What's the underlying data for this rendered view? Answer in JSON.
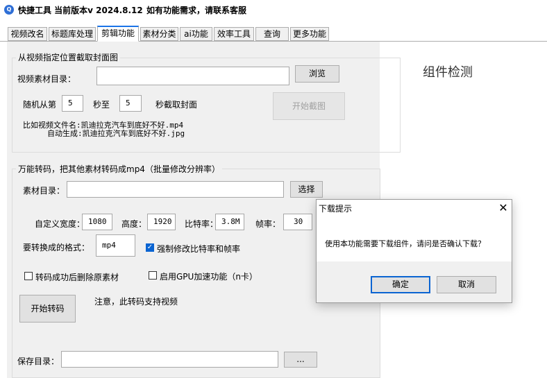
{
  "window": {
    "icon": "app-logo-icon",
    "title": "快捷工具 当前版本v 2024.8.12",
    "notice": "如有功能需求，请联系客服"
  },
  "tabs": [
    {
      "label": "视频改名",
      "active": false
    },
    {
      "label": "标题库处理",
      "active": false
    },
    {
      "label": "剪辑功能",
      "active": true
    },
    {
      "label": "素材分类",
      "active": false
    },
    {
      "label": "ai功能",
      "active": false
    },
    {
      "label": "效率工具",
      "active": false
    },
    {
      "label": "查询",
      "active": false
    },
    {
      "label": "更多功能",
      "active": false
    }
  ],
  "cover_section": {
    "title": "从视频指定位置截取封面图",
    "dir_label": "视频素材目录：",
    "dir_value": "",
    "browse_button": "浏览",
    "random_from": "随机从第",
    "from_value": "5",
    "sec_to": "秒至",
    "to_value": "5",
    "sec_capture": "秒截取封面",
    "start_button": "开始截图",
    "example_line1": "比如视频文件名:凯迪拉克汽车到底好不好.mp4",
    "example_line2": "自动生成:凯迪拉克汽车到底好不好.jpg"
  },
  "transcode_section": {
    "title": "万能转码，把其他素材转码成mp4（批量修改分辨率）",
    "dir_label": "素材目录：",
    "dir_value": "",
    "select_button": "选择",
    "width_label": "自定义宽度：",
    "width_value": "1080",
    "height_label": "高度：",
    "height_value": "1920",
    "bitrate_label": "比特率：",
    "bitrate_value": "3.8M",
    "fps_label": "帧率：",
    "fps_value": "30",
    "format_label": "要转换成的格式：",
    "format_value": "mp4",
    "force_label": "强制修改比特率和帧率",
    "force_checked": true,
    "delete_label": "转码成功后删除原素材",
    "delete_checked": false,
    "gpu_label": "启用GPU加速功能（n卡）",
    "gpu_checked": false,
    "start_button": "开始转码",
    "note": "注意，此转码支持视频",
    "save_label": "保存目录：",
    "save_value": "",
    "save_button": "..."
  },
  "side": {
    "title": "组件检测"
  },
  "dialog": {
    "title": "下载提示",
    "message": "使用本功能需要下载组件，请问是否确认下载？",
    "ok": "确定",
    "cancel": "取消",
    "close_icon": "close-icon"
  },
  "colors": {
    "accent": "#0a64d2",
    "tab_active_border": "#1a73e8",
    "panel_bg": "#f0f0f0"
  }
}
